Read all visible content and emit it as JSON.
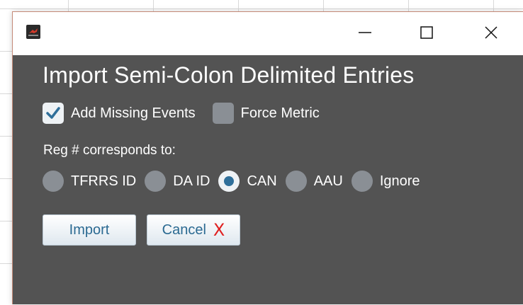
{
  "window": {
    "title_bar": {
      "minimize_glyph": "—",
      "maximize_glyph": "☐",
      "close_glyph": "✕"
    }
  },
  "dialog": {
    "title": "Import Semi-Colon Delimited Entries",
    "checkboxes": [
      {
        "label": "Add Missing Events",
        "checked": true
      },
      {
        "label": "Force Metric",
        "checked": false
      }
    ],
    "reg_label": "Reg # corresponds to:",
    "reg_options": [
      {
        "label": "TFRRS ID",
        "selected": false
      },
      {
        "label": "DA ID",
        "selected": false
      },
      {
        "label": "CAN",
        "selected": true
      },
      {
        "label": "AAU",
        "selected": false
      },
      {
        "label": "Ignore",
        "selected": false
      }
    ],
    "buttons": {
      "import_label": "Import",
      "cancel_label": "Cancel",
      "cancel_glyph": "X"
    }
  },
  "colors": {
    "dialog_bg": "#535353",
    "accent_blue": "#2f6f9a",
    "button_text": "#2b6a92",
    "cancel_x": "#e02020"
  },
  "icons": {
    "app": "app-logo-icon",
    "checkmark": "checkmark-icon"
  }
}
